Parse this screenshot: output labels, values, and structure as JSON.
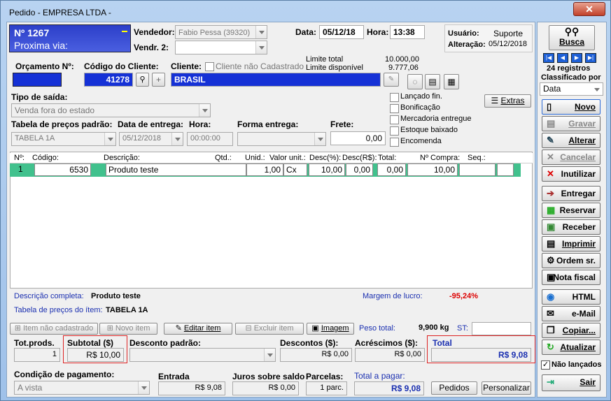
{
  "window": {
    "title": "Pedido - EMPRESA LTDA -",
    "close": "✕"
  },
  "order": {
    "number": "Nº 1267",
    "via": "Proxima via:"
  },
  "vendor": {
    "label": "Vendedor:",
    "value": "Fabio Pessa (39320)",
    "label2": "Vendr. 2:",
    "value2": ""
  },
  "date": {
    "label": "Data:",
    "value": "05/12/18",
    "hora_label": "Hora:",
    "hora": "13:38"
  },
  "user": {
    "label": "Usuário:",
    "value": "Suporte",
    "alter_label": "Alteração:",
    "alter": "05/12/2018"
  },
  "budget": {
    "label": "Orçamento Nº:",
    "value": ""
  },
  "client": {
    "code_label": "Código do Cliente:",
    "code": "41278",
    "label": "Cliente:",
    "not_registered": "Cliente não Cadastrado",
    "name": "BRASIL",
    "limit_total_label": "Limite total",
    "limit_total": "10.000,00",
    "limit_avail_label": "Limite disponível",
    "limit_avail": "9.777,06"
  },
  "sale": {
    "type_label": "Tipo de saída:",
    "type": "Venda fora do estado",
    "price_table_label": "Tabela de preços padrão:",
    "price_table": "TABELA 1A",
    "delivery_label": "Data de entrega:",
    "delivery": "05/12/2018",
    "hour_label": "Hora:",
    "hour": "00:00:00",
    "form_label": "Forma entrega:",
    "form": "",
    "freight_label": "Frete:",
    "freight": "0,00"
  },
  "checks": [
    "Lançado fin.",
    "Bonificação",
    "Mercadoria entregue",
    "Estoque baixado",
    "Encomenda"
  ],
  "extras": "Extras",
  "grid": {
    "headers": [
      "Nº:",
      "Código:",
      "Descrição:",
      "Qtd.:",
      "Unid.:",
      "Valor unit.:",
      "Desc(%):",
      "Desc(R$):",
      "Total:",
      "Nº Compra:",
      "Seq.:"
    ],
    "row": {
      "n": "1",
      "code": "6530",
      "desc": "Produto teste",
      "qtd": "1,00",
      "unit": "Cx",
      "val": "10,00",
      "descp": "0,00",
      "descr": "0,00",
      "total": "10,00"
    }
  },
  "info": {
    "desc_label": "Descrição completa:",
    "desc": "Produto teste",
    "margin_label": "Margem de lucro:",
    "margin": "-95,24%",
    "table_label": "Tabela de preços do ítem:",
    "table": "TABELA 1A"
  },
  "item_actions": {
    "not_registered": "Item não cadastrado",
    "new": "Novo item",
    "edit": "Editar item",
    "delete": "Excluir item",
    "image": "Imagem",
    "weight_label": "Peso total:",
    "weight": "9,900 kg",
    "st_label": "ST:",
    "st": ""
  },
  "totals": {
    "prods_label": "Tot.prods.",
    "prods": "1",
    "subtotal_label": "Subtotal ($)",
    "subtotal": "R$ 10,00",
    "disc_std_label": "Desconto padrão:",
    "disc_label": "Descontos ($):",
    "disc": "R$ 0,00",
    "add_label": "Acréscimos ($):",
    "add": "R$ 0,00",
    "total_label": "Total",
    "total": "R$ 9,08"
  },
  "payment": {
    "cond_label": "Condição de pagamento:",
    "cond": "A vista",
    "entry_label": "Entrada",
    "entry": "R$ 9,08",
    "interest_label": "Juros sobre saldo",
    "interest": "R$ 0,00",
    "parcels_label": "Parcelas:",
    "parcels": "1 parc.",
    "topay_label": "Total a pagar:",
    "topay": "R$ 9,08",
    "orders": "Pedidos",
    "customize": "Personalizar"
  },
  "side": {
    "search": "Busca",
    "records": "24 registros",
    "sorted": "Classificado por",
    "sort_value": "Data",
    "new": "Novo",
    "save": "Gravar",
    "edit": "Alterar",
    "cancel": "Cancelar",
    "void": "Inutilizar",
    "deliver": "Entregar",
    "reserve": "Reservar",
    "receive": "Receber",
    "print": "Imprimir",
    "service": "Ordem sr.",
    "invoice": "Nota fiscal",
    "html": "HTML",
    "email": "e-Mail",
    "copy": "Copiar...",
    "update": "Atualizar",
    "not_posted": "Não lançados",
    "exit": "Sair"
  }
}
